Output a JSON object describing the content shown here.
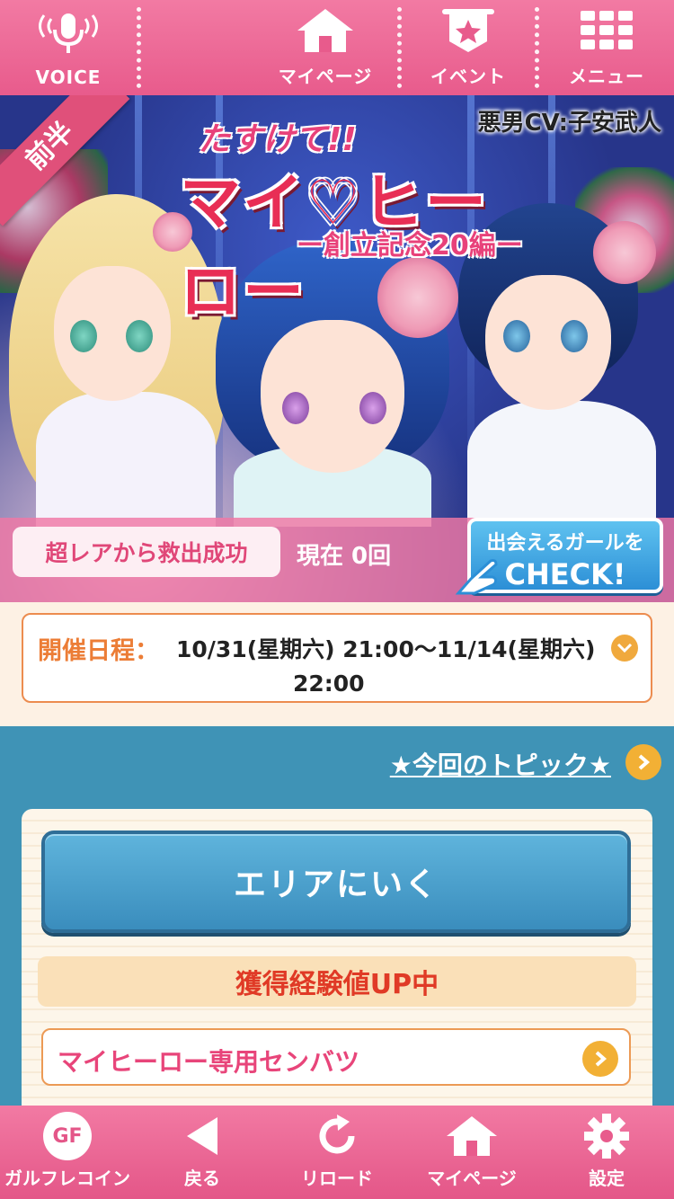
{
  "top_nav": {
    "voice_label": "VOICE",
    "mypage_label": "マイページ",
    "event_label": "イベント",
    "menu_label": "メニュー"
  },
  "banner": {
    "ribbon": "前半",
    "cv_credit": "悪男CV:子安武人",
    "logo_small": "たすけて!!",
    "logo_main": "マイ♡ヒーロー",
    "logo_sub": "ー創立記念20編ー",
    "rescue_label": "超レアから救出成功",
    "rescue_count": "現在 0回",
    "check_line1": "出会えるガールを",
    "check_line2": "CHECK!"
  },
  "schedule": {
    "label": "開催日程：",
    "line1": "10/31(星期六) 21:00〜11/14(星期六)",
    "line2": "22:00"
  },
  "main": {
    "topic_link": "★今回のトピック★",
    "area_button": "エリアにいく",
    "exp_badge": "獲得経験値UP中",
    "senbatsu_button": "マイヒーロー専用センバツ"
  },
  "bottom_nav": {
    "coin_icon_text": "GF",
    "coin_label": "ガルフレコイン",
    "back_label": "戻る",
    "reload_label": "リロード",
    "mypage_label": "マイページ",
    "settings_label": "設定"
  },
  "colors": {
    "nav_pink": "#e85b8c",
    "main_blue": "#3f93b6",
    "accent_orange": "#f2b035",
    "text_pink": "#e8457a"
  }
}
